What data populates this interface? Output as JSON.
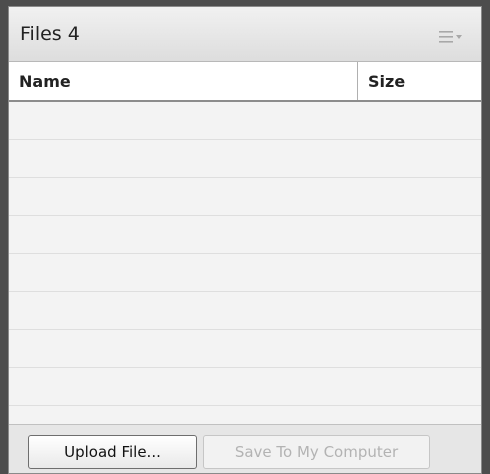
{
  "panel": {
    "title": "Files 4",
    "menu_icon": "hamburger-menu-dropdown-icon"
  },
  "table": {
    "columns": [
      "Name",
      "Size"
    ],
    "rows": []
  },
  "footer": {
    "upload_label": "Upload File...",
    "save_label": "Save To My Computer",
    "save_enabled": false
  },
  "colors": {
    "frame": "#4d4d4d",
    "panel_bg": "#f3f3f3",
    "disabled_text": "#b3b3b3"
  }
}
